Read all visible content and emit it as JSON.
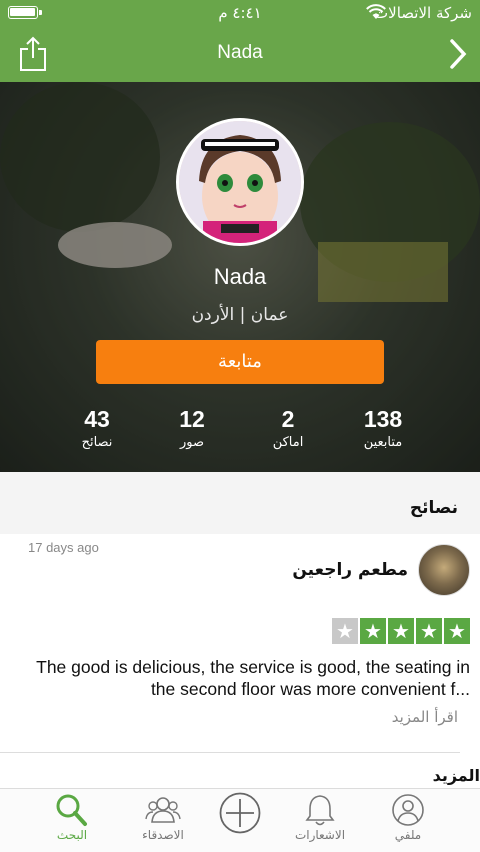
{
  "status_bar": {
    "carrier": "شركة الاتصالات",
    "time": "٤:٤١ م"
  },
  "nav": {
    "title": "Nada",
    "icons": {
      "left": "share-icon",
      "right": "chevron-right-icon"
    }
  },
  "profile": {
    "name": "Nada",
    "location": "عمان | الأردن",
    "follow_label": "متابعة",
    "stats": [
      {
        "value": "43",
        "label": "نصائح"
      },
      {
        "value": "12",
        "label": "صور"
      },
      {
        "value": "2",
        "label": "اماكن"
      },
      {
        "value": "138",
        "label": "متابعين"
      }
    ]
  },
  "tips_section": {
    "title": "نصائح",
    "tip": {
      "date": "17 days ago",
      "venue": "مطعم راجعين",
      "rating": 4,
      "rating_max": 5,
      "text": "The good is delicious, the service is good, the seating in the second floor was more convenient f...",
      "read_more": "اقرأ المزيد"
    }
  },
  "more_label": "المزيد",
  "tab_bar": {
    "search": "البحث",
    "friends": "الاصدقاء",
    "notifications": "الاشعارات",
    "profile": "ملفي"
  },
  "colors": {
    "brand_green": "#69a64a",
    "follow_orange": "#f77f0f",
    "star_green": "#5aa843",
    "star_empty": "#c8c8c8"
  }
}
